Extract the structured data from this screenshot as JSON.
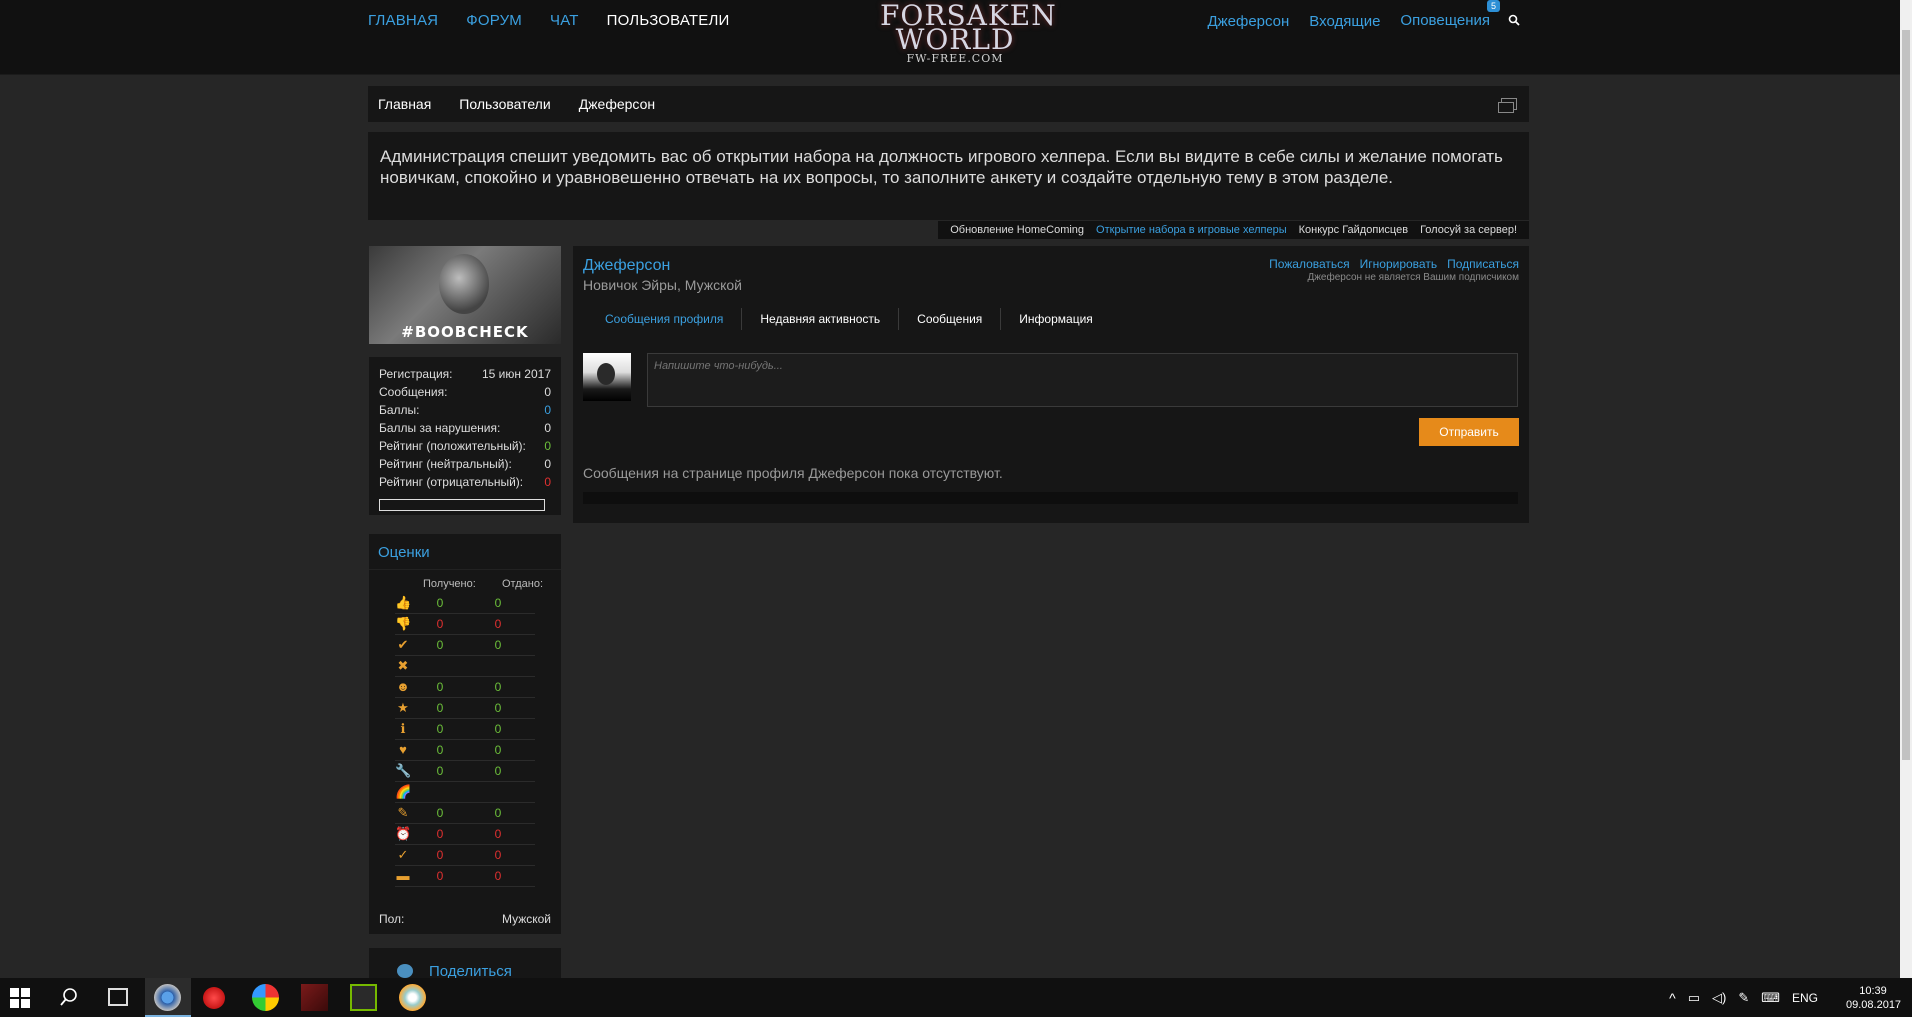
{
  "topnav": {
    "home": "ГЛАВНАЯ",
    "forum": "ФОРУМ",
    "chat": "ЧАТ",
    "users": "ПОЛЬЗОВАТЕЛИ",
    "account": "Джеферсон",
    "inbox": "Входящие",
    "alerts": "Оповещения",
    "alerts_count": "5"
  },
  "logo": {
    "line1": "FORSAKEN",
    "line2": "WORLD",
    "line3": "FW-FREE.COM"
  },
  "breadcrumb": [
    "Главная",
    "Пользователи",
    "Джеферсон"
  ],
  "notice": "Администрация спешит уведомить вас об открытии набора на должность игрового хелпера. Если вы видите в себе силы и желание помогать новичкам, спокойно и уравновешенно отвечать на их вопросы, то заполните анкету и создайте отдельную тему в этом разделе.",
  "ticker": [
    "Обновление HomeComing",
    "Открытие набора в игровые хелперы",
    "Конкурс Гайдописцев",
    "Голосуй за сервер!"
  ],
  "avatar_tag": "#BOOBCHECK",
  "stats": [
    {
      "label": "Регистрация:",
      "value": "15 июн 2017",
      "color": ""
    },
    {
      "label": "Сообщения:",
      "value": "0",
      "color": ""
    },
    {
      "label": "Баллы:",
      "value": "0",
      "color": "blue"
    },
    {
      "label": "Баллы за нарушения:",
      "value": "0",
      "color": ""
    },
    {
      "label": "Рейтинг (положительный):",
      "value": "0",
      "color": "green"
    },
    {
      "label": "Рейтинг (нейтральный):",
      "value": "0",
      "color": ""
    },
    {
      "label": "Рейтинг (отрицательный):",
      "value": "0",
      "color": "red"
    }
  ],
  "ratings": {
    "title": "Оценки",
    "received_label": "Получено:",
    "given_label": "Отдано:",
    "rows": [
      {
        "icon": "thumbs-up-icon",
        "glyph": "👍",
        "received": "0",
        "given": "0",
        "color": "green"
      },
      {
        "icon": "thumbs-down-icon",
        "glyph": "👎",
        "received": "0",
        "given": "0",
        "color": "red"
      },
      {
        "icon": "check-icon",
        "glyph": "✔",
        "received": "0",
        "given": "0",
        "color": "green"
      },
      {
        "icon": "cross-icon",
        "glyph": "✖",
        "received": "",
        "given": "",
        "color": "dim"
      },
      {
        "icon": "smile-icon",
        "glyph": "☻",
        "received": "0",
        "given": "0",
        "color": "green"
      },
      {
        "icon": "star-icon",
        "glyph": "★",
        "received": "0",
        "given": "0",
        "color": "green"
      },
      {
        "icon": "info-icon",
        "glyph": "ℹ",
        "received": "0",
        "given": "0",
        "color": "green"
      },
      {
        "icon": "heart-icon",
        "glyph": "♥",
        "received": "0",
        "given": "0",
        "color": "green"
      },
      {
        "icon": "wrench-icon",
        "glyph": "🔧",
        "received": "0",
        "given": "0",
        "color": "green"
      },
      {
        "icon": "rainbow-icon",
        "glyph": "🌈",
        "received": "",
        "given": "",
        "color": "dim"
      },
      {
        "icon": "pencil-icon",
        "glyph": "✎",
        "received": "0",
        "given": "0",
        "color": "green"
      },
      {
        "icon": "alarm-clock-icon",
        "glyph": "⏰",
        "received": "0",
        "given": "0",
        "color": "red"
      },
      {
        "icon": "abc-check-icon",
        "glyph": "✓",
        "received": "0",
        "given": "0",
        "color": "red"
      },
      {
        "icon": "box-icon",
        "glyph": "▬",
        "received": "0",
        "given": "0",
        "color": "red"
      }
    ]
  },
  "gender": {
    "label": "Пол:",
    "value": "Мужской"
  },
  "share": "Поделиться",
  "profile": {
    "name": "Джеферсон",
    "title": "Новичок Эйры, Мужской",
    "actions": [
      "Пожаловаться",
      "Игнорировать",
      "Подписаться"
    ],
    "follow_status": "Джеферсон не является Вашим подписчиком",
    "tabs": [
      "Сообщения профиля",
      "Недавняя активность",
      "Сообщения",
      "Информация"
    ],
    "compose_placeholder": "Напишите что-нибудь...",
    "send_label": "Отправить",
    "empty_message": "Сообщения на странице профиля Джеферсон пока отсутствуют."
  },
  "taskbar": {
    "lang": "ENG",
    "time": "10:39",
    "date": "09.08.2017"
  },
  "colors": {
    "accent": "#3ba0e0",
    "button": "#e68a1a",
    "positive": "#6cbf3a",
    "negative": "#e03030"
  }
}
